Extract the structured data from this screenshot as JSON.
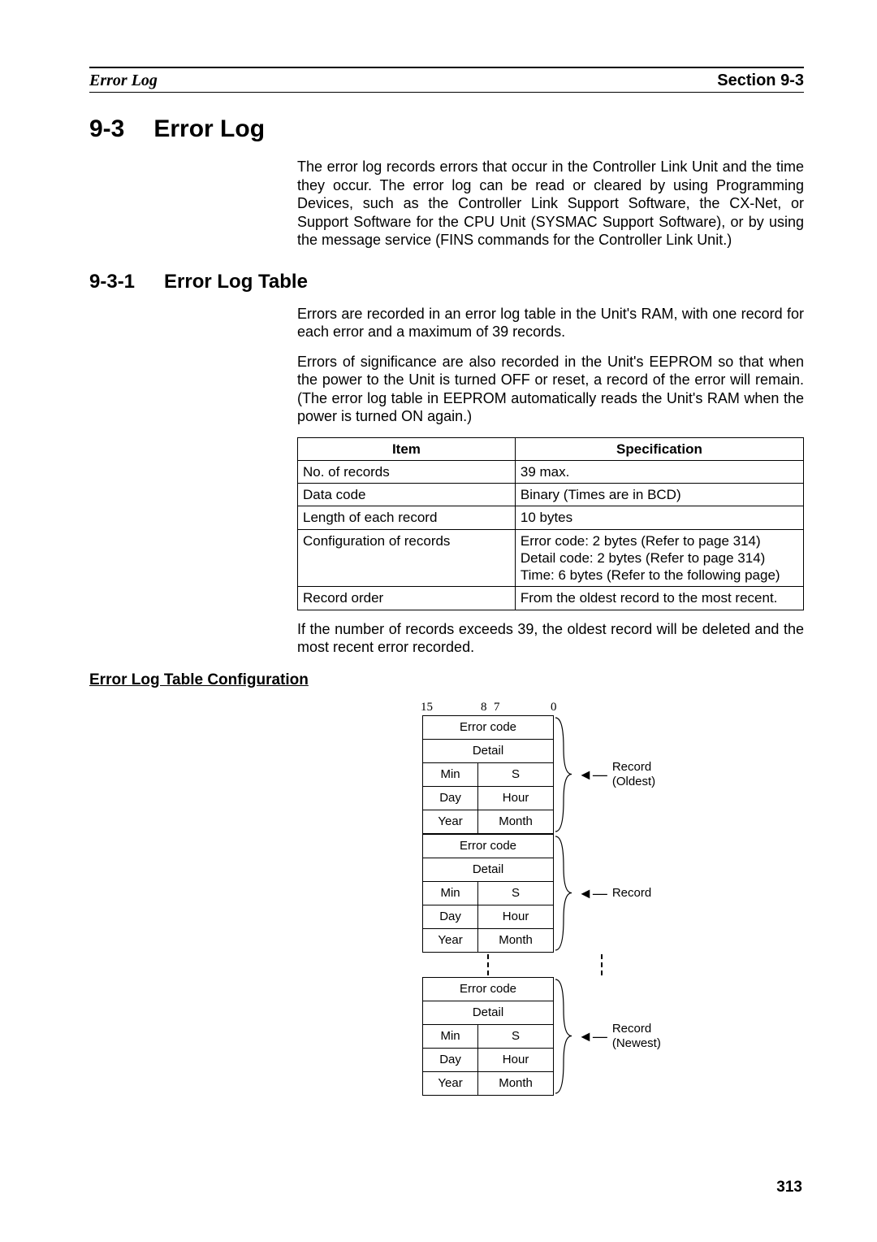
{
  "header": {
    "left": "Error Log",
    "right_label": "Section",
    "right_num": "9-3"
  },
  "h1": {
    "num": "9-3",
    "title": "Error Log"
  },
  "intro_para": "The error log records errors that occur in the Controller Link Unit and the time they occur. The error log can be read or cleared by using Programming Devices, such as the Controller Link Support Software, the CX-Net, or Support Software for the CPU Unit (SYSMAC Support Software), or by using the message service (FINS commands for the Controller Link Unit.)",
  "h2": {
    "num": "9-3-1",
    "title": "Error Log Table"
  },
  "para1": "Errors are recorded in an error log table in the Unit's RAM, with one record for each error and a maximum of 39 records.",
  "para2": "Errors of significance are also recorded in the Unit's EEPROM so that when the power to the Unit is turned OFF or reset, a record of the error will remain. (The error log table in EEPROM automatically reads the Unit's RAM when the power is turned ON again.)",
  "table": {
    "head_item": "Item",
    "head_spec": "Specification",
    "rows": [
      {
        "item": "No. of records",
        "spec": "39 max."
      },
      {
        "item": "Data code",
        "spec": "Binary (Times are in BCD)"
      },
      {
        "item": "Length of each record",
        "spec": "10 bytes"
      },
      {
        "item": "Configuration of records",
        "spec": "Error code: 2 bytes (Refer to page 314)\nDetail code: 2 bytes (Refer to page 314)\nTime: 6 bytes (Refer to the following page)"
      },
      {
        "item": "Record order",
        "spec": "From the oldest record to the most recent."
      }
    ]
  },
  "para3": "If the number of records exceeds 39, the oldest record will be deleted and the most recent error recorded.",
  "h3": "Error Log Table Configuration",
  "diagram": {
    "bits": {
      "b15": "15",
      "b8": "8",
      "b7": "7",
      "b0": "0"
    },
    "rows": {
      "error_code": "Error code",
      "detail": "Detail",
      "min": "Min",
      "s": "S",
      "day": "Day",
      "hour": "Hour",
      "year": "Year",
      "month": "Month"
    },
    "labels": {
      "oldest": "Record\n(Oldest)",
      "record": "Record",
      "newest": "Record\n(Newest)"
    }
  },
  "page_number": "313"
}
